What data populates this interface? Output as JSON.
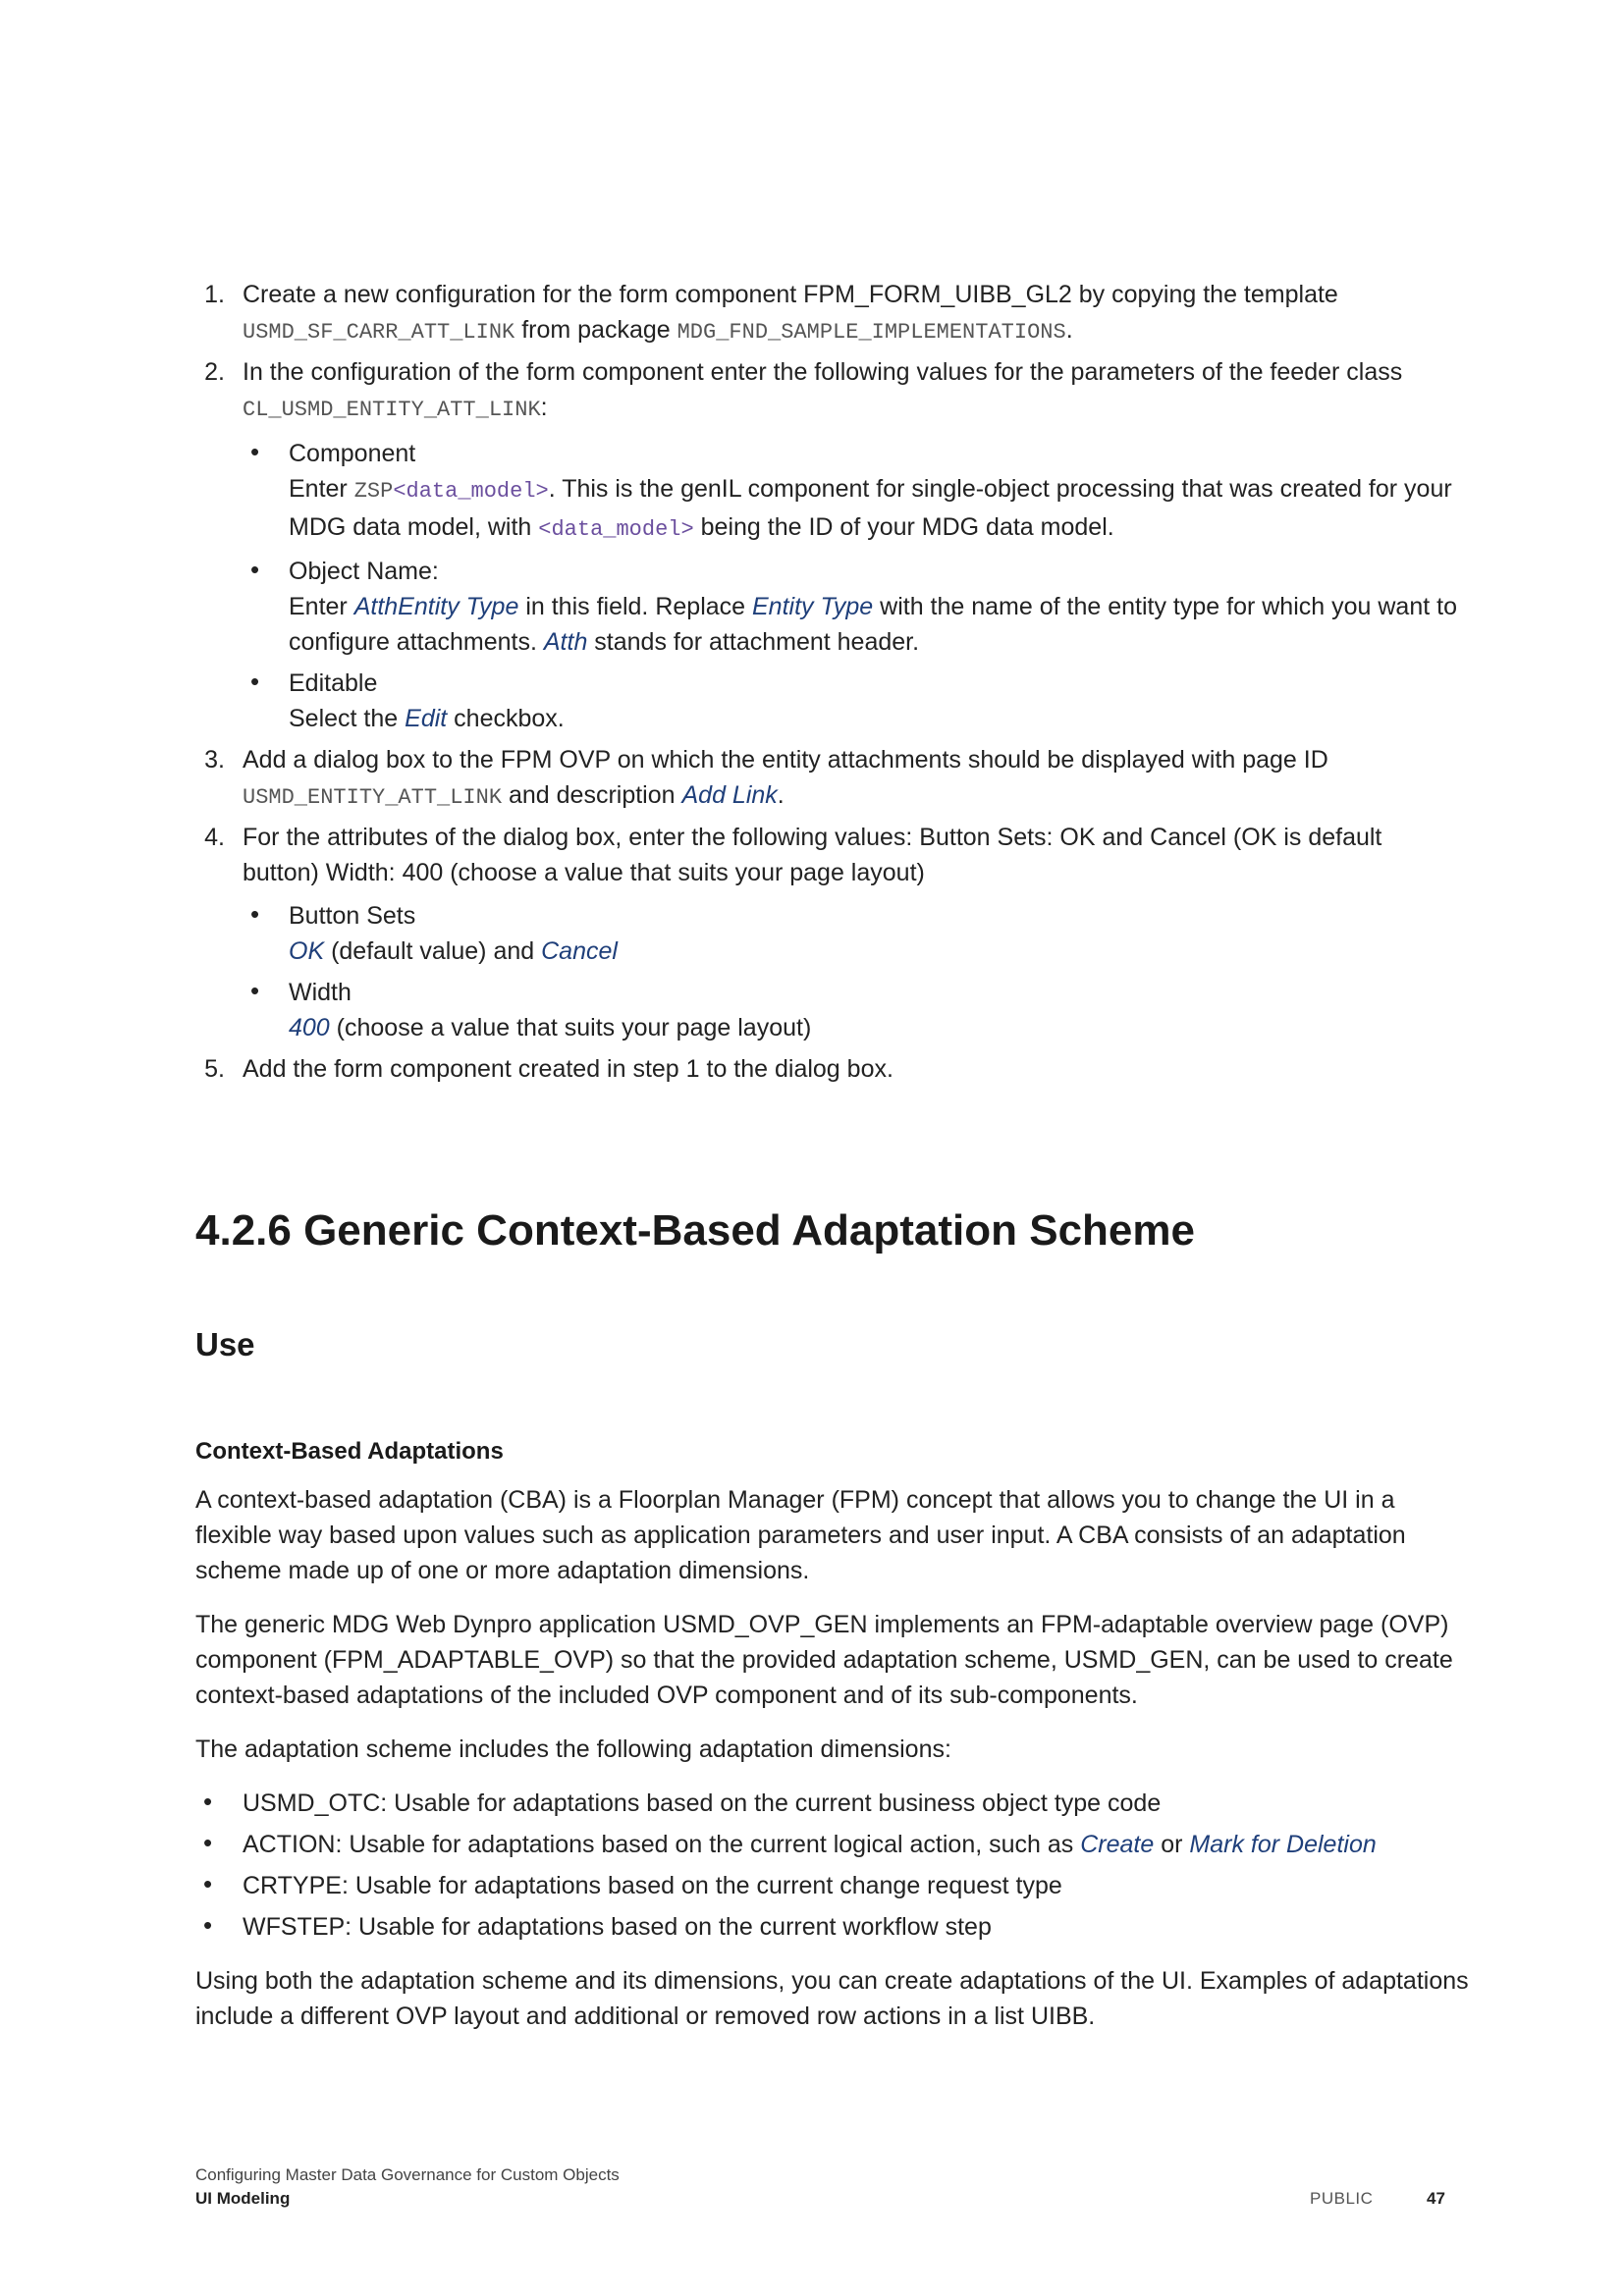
{
  "steps": [
    {
      "num": "1.",
      "a": "Create a new configuration for the form component FPM_FORM_UIBB_GL2 by copying the template ",
      "code1": "USMD_SF_CARR_ATT_LINK",
      "b": " from package ",
      "code2": "MDG_FND_SAMPLE_IMPLEMENTATIONS",
      "c": "."
    },
    {
      "num": "2.",
      "a": "In the configuration of the form component enter the following values for the parameters of the feeder class ",
      "code1": "CL_USMD_ENTITY_ATT_LINK",
      "b": ":",
      "bullets": [
        {
          "title": "Component",
          "a": "Enter ",
          "code1": "ZSP",
          "ph1": "<data_model>",
          "b": ". This is the genIL component for single-object processing that was created for your MDG data model, with ",
          "ph2": "<data_model>",
          "c": " being the ID of your MDG data model."
        },
        {
          "title": "Object Name:",
          "a": "Enter ",
          "em1": "AtthEntity Type",
          "b": " in this field. Replace ",
          "em2": "Entity Type",
          "c": " with the name of the entity type for which you want to configure attachments. ",
          "em3": "Atth",
          "d": " stands for attachment header."
        },
        {
          "title": "Editable",
          "a": "Select the ",
          "em1": "Edit",
          "b": " checkbox."
        }
      ]
    },
    {
      "num": "3.",
      "a": "Add a dialog box to the FPM OVP on which the entity attachments should be displayed with page ID ",
      "code1": "USMD_ENTITY_ATT_LINK",
      "b": " and description ",
      "em1": "Add Link",
      "c": "."
    },
    {
      "num": "4.",
      "a": "For the attributes of the dialog box, enter the following values: Button Sets: OK and Cancel (OK is default button) Width: 400 (choose a value that suits your page layout)",
      "bullets": [
        {
          "title": "Button Sets",
          "em1": "OK",
          "a": " (default value) and ",
          "em2": "Cancel"
        },
        {
          "title": "Width",
          "em1": "400",
          "a": " (choose a value that suits your page layout)"
        }
      ]
    },
    {
      "num": "5.",
      "a": "Add the form component created in step 1 to the dialog box."
    }
  ],
  "section": {
    "heading": "4.2.6  Generic Context-Based Adaptation Scheme",
    "use_heading": "Use",
    "cba_heading": "Context-Based Adaptations",
    "p1": "A context-based adaptation (CBA) is a Floorplan Manager (FPM) concept that allows you to change the UI in a flexible way based upon values such as application parameters and user input. A CBA consists of an adaptation scheme made up of one or more adaptation dimensions.",
    "p2": "The generic MDG Web Dynpro application USMD_OVP_GEN implements an FPM-adaptable overview page (OVP) component (FPM_ADAPTABLE_OVP) so that the provided adaptation scheme, USMD_GEN, can be used to create context-based adaptations of the included OVP component and of its sub-components.",
    "p3": "The adaptation scheme includes the following adaptation dimensions:",
    "dims": {
      "d1": "USMD_OTC: Usable for adaptations based on the current business object type code",
      "d2a": "ACTION: Usable for adaptations based on the current logical action, such as ",
      "d2em1": "Create",
      "d2b": " or ",
      "d2em2": "Mark for Deletion",
      "d3": "CRTYPE: Usable for adaptations based on the current change request type",
      "d4": "WFSTEP: Usable for adaptations based on the current workflow step"
    },
    "p4": "Using both the adaptation scheme and its dimensions, you can create adaptations of the UI. Examples of adaptations include a different OVP layout and additional or removed row actions in a list UIBB."
  },
  "footer": {
    "doc_title": "Configuring Master Data Governance for Custom Objects",
    "chapter": "UI Modeling",
    "classification": "PUBLIC",
    "page": "47"
  }
}
